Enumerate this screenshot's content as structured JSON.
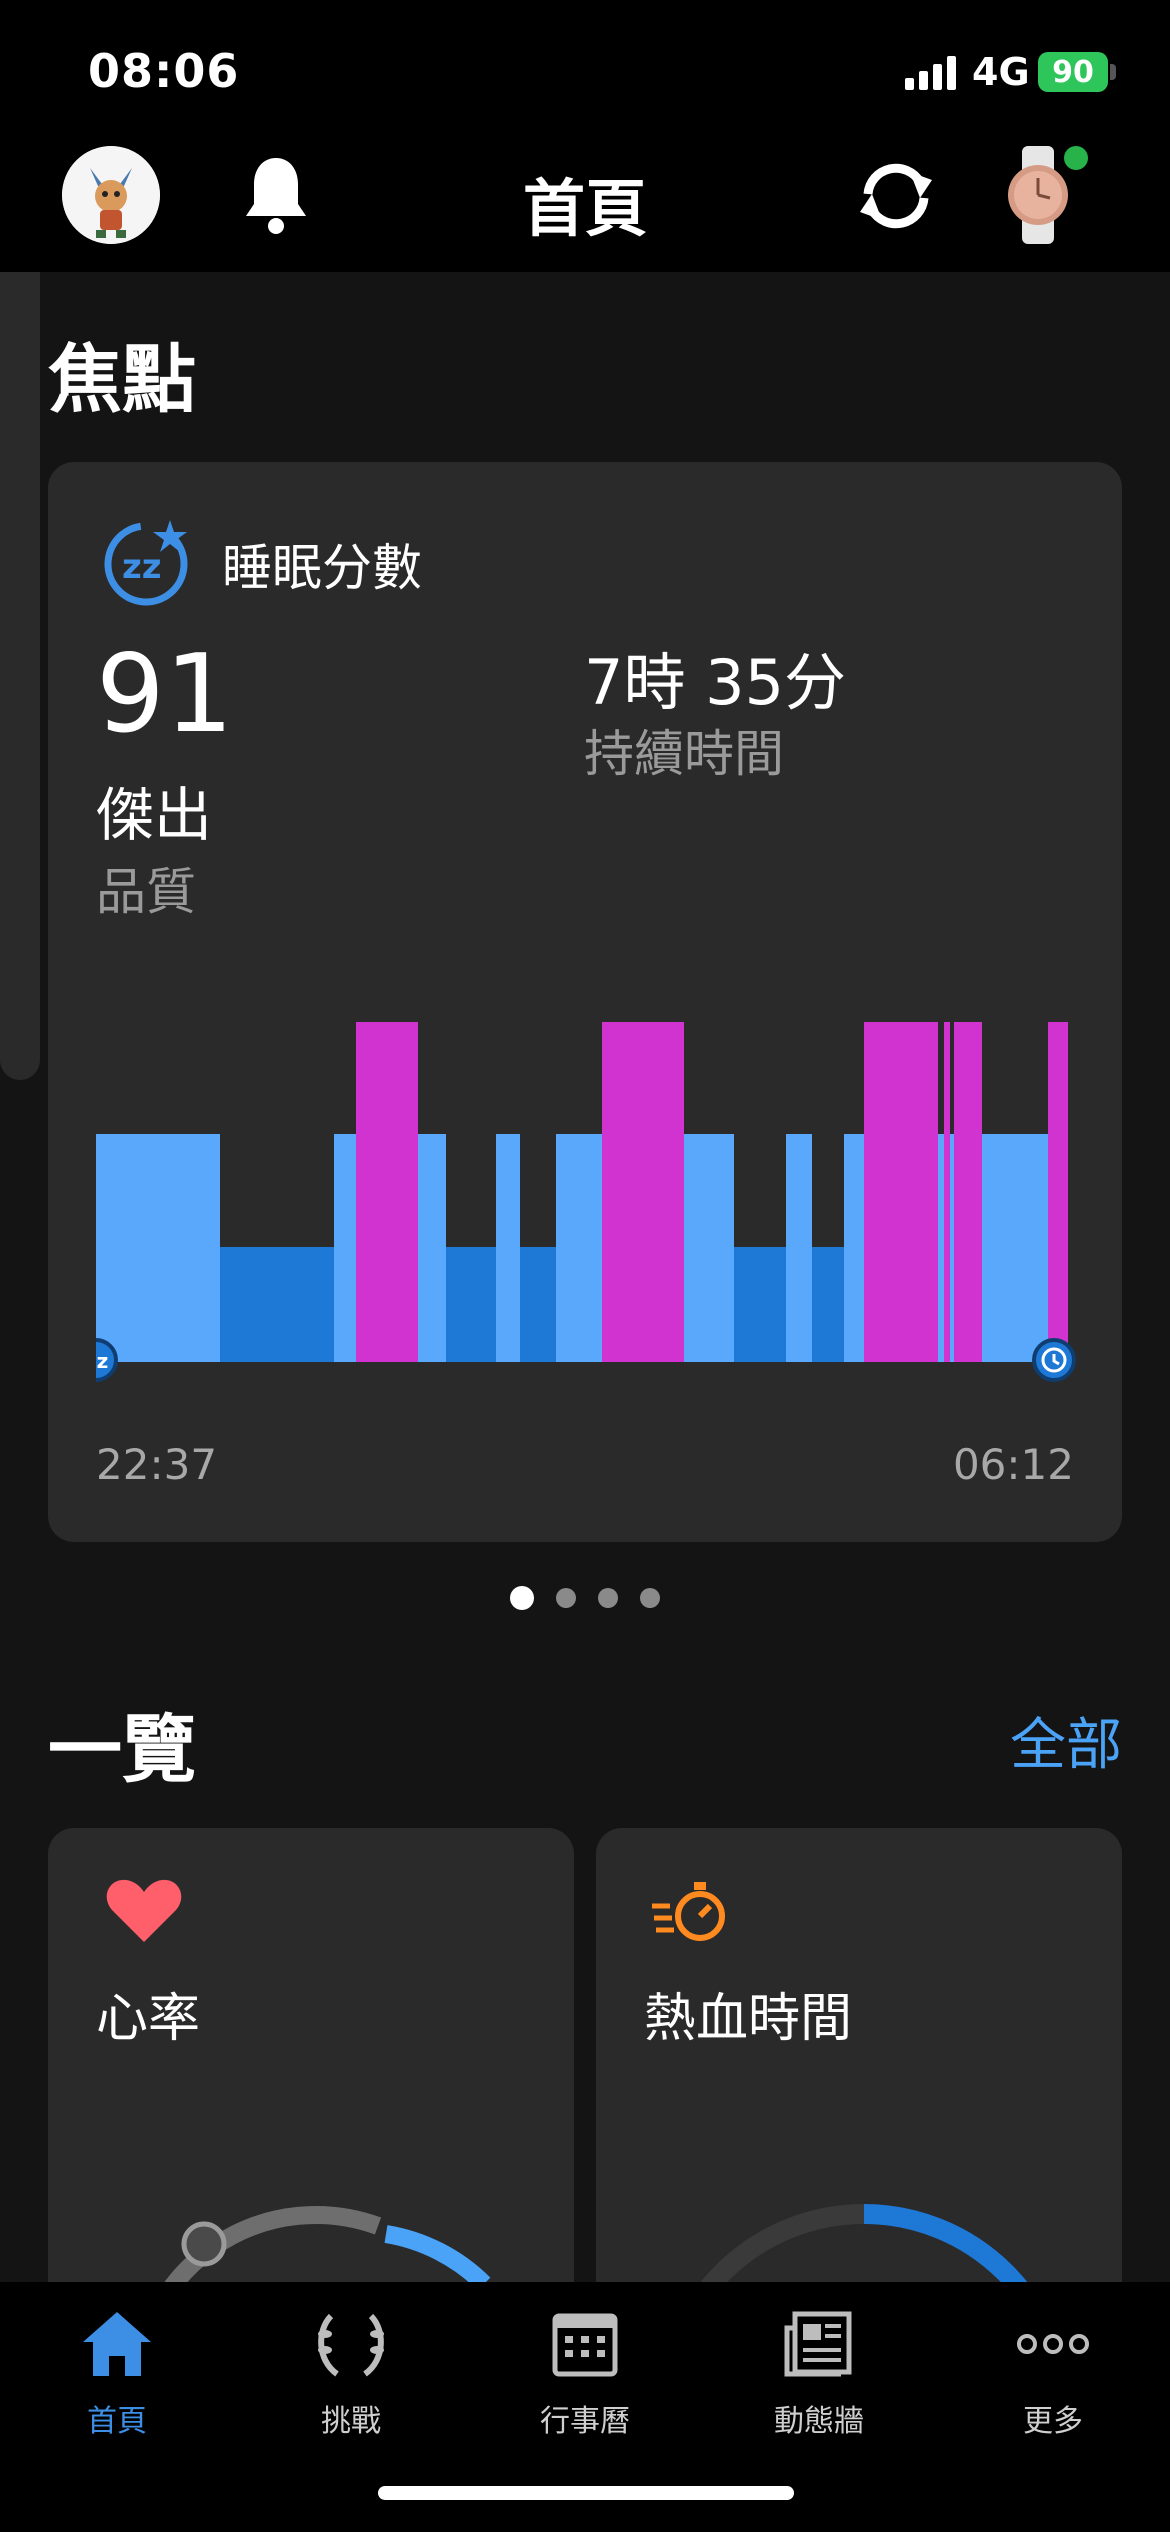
{
  "status_bar": {
    "time": "08:06",
    "network": "4G",
    "battery": "90"
  },
  "header": {
    "title": "首頁"
  },
  "focus": {
    "section_title": "焦點",
    "sleep_card": {
      "label": "睡眠分數",
      "score": "91",
      "quality": "傑出",
      "quality_label": "品質",
      "duration": "7時 35分",
      "duration_label": "持續時間",
      "start_time": "22:37",
      "end_time": "06:12",
      "colors": {
        "light": "#5aa8fb",
        "deep": "#1e78d6",
        "rem": "#d033cf"
      }
    },
    "pager": {
      "count": 4,
      "active": 0
    }
  },
  "overview": {
    "section_title": "一覽",
    "see_all": "全部",
    "cards": [
      {
        "label": "心率",
        "icon": "heart-icon"
      },
      {
        "label": "熱血時間",
        "icon": "stopwatch-icon"
      }
    ]
  },
  "tabs": [
    {
      "label": "首頁",
      "icon": "home-icon",
      "active": true
    },
    {
      "label": "挑戰",
      "icon": "laurel-icon",
      "active": false
    },
    {
      "label": "行事曆",
      "icon": "calendar-icon",
      "active": false
    },
    {
      "label": "動態牆",
      "icon": "newsfeed-icon",
      "active": false
    },
    {
      "label": "更多",
      "icon": "more-icon",
      "active": false
    }
  ]
}
